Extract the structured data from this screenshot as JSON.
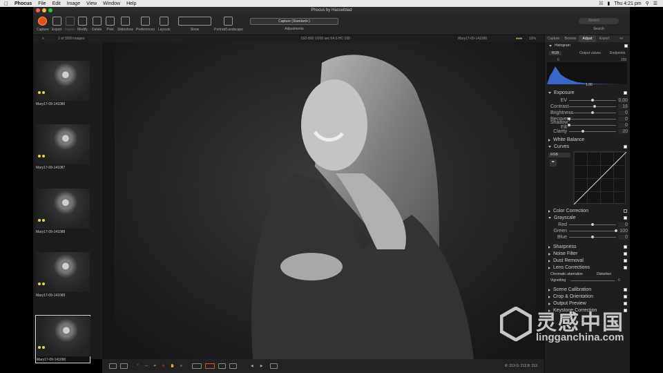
{
  "menubar": {
    "app": "Phocus",
    "items": [
      "File",
      "Edit",
      "Image",
      "View",
      "Window",
      "Help"
    ],
    "clock": "Thu 4:21 pm"
  },
  "window": {
    "title": "Phocus by Hasselblad"
  },
  "toolbar": {
    "buttons": [
      "Capture",
      "Export",
      "Import",
      "Modify",
      "Delete",
      "Print",
      "Slideshow",
      "Preferences",
      "Layouts",
      "Show",
      "Portrait/Landscape",
      "Adjustments",
      "Search"
    ],
    "mode": "Capture (Standard+)",
    "search_placeholder": "Search"
  },
  "status": {
    "count": "1 of 1099 images",
    "exif": "ISO 800   1/200 sec   f/4.5   HC 100",
    "filename": "Mary17-09-141090",
    "zoom": "16%"
  },
  "thumbnails": [
    {
      "label": "Mary17-09-141086"
    },
    {
      "label": "Mary17-09-141087"
    },
    {
      "label": "Mary17-09-141088"
    },
    {
      "label": "Mary17-09-141089"
    },
    {
      "label": "Mary17-09-141090",
      "selected": true
    }
  ],
  "bottom": {
    "readout": "R: 213  G: 213  B: 213"
  },
  "panel": {
    "tabs": [
      "Capture",
      "Browse",
      "Adjust",
      "Export",
      "+≡"
    ],
    "active_tab": "Adjust",
    "histogram": {
      "title": "Histogram",
      "mode": "RGB",
      "output_values": "Output values",
      "endpoints": "Endpoints",
      "low": "0",
      "mid": "1.00",
      "high": "255"
    },
    "exposure": {
      "title": "Exposure",
      "sliders": [
        {
          "name": "EV",
          "value": "0.00",
          "level": 0.5
        },
        {
          "name": "Contrast",
          "value": "16",
          "level": 0.55
        },
        {
          "name": "Brightness",
          "value": "0",
          "level": 0.5
        },
        {
          "name": "Recovery",
          "value": "0",
          "level": 0.0
        },
        {
          "name": "Shadow Fill",
          "value": "0",
          "level": 0.0
        },
        {
          "name": "Clarity",
          "value": "20",
          "level": 0.3
        }
      ]
    },
    "white_balance": "White Balance",
    "curves": {
      "title": "Curves",
      "mode": "RGB"
    },
    "color_correction": "Color Correction",
    "grayscale": {
      "title": "Grayscale",
      "sliders": [
        {
          "name": "Red",
          "value": "0",
          "level": 0.5
        },
        {
          "name": "Green",
          "value": "100",
          "level": 1.0
        },
        {
          "name": "Blue",
          "value": "0",
          "level": 0.5
        }
      ]
    },
    "sections_after": [
      "Sharpness",
      "Noise Filter",
      "Dust Removal",
      "Lens Corrections"
    ],
    "lens": {
      "chromatic": "Chromatic aberration",
      "distortion": "Distortion",
      "vignetting": "Vignetting",
      "vignetting_value": "0"
    },
    "sections_end": [
      "Scene Calibration",
      "Crop & Orientation",
      "Output Preview",
      "Keystone Correction"
    ]
  },
  "watermark": {
    "cn": "灵感中国",
    "url": "lingganchina.com"
  },
  "colors": {
    "record": "#e0541d",
    "panel": "#1f1f1f",
    "viewer": "#1a1a1a"
  }
}
